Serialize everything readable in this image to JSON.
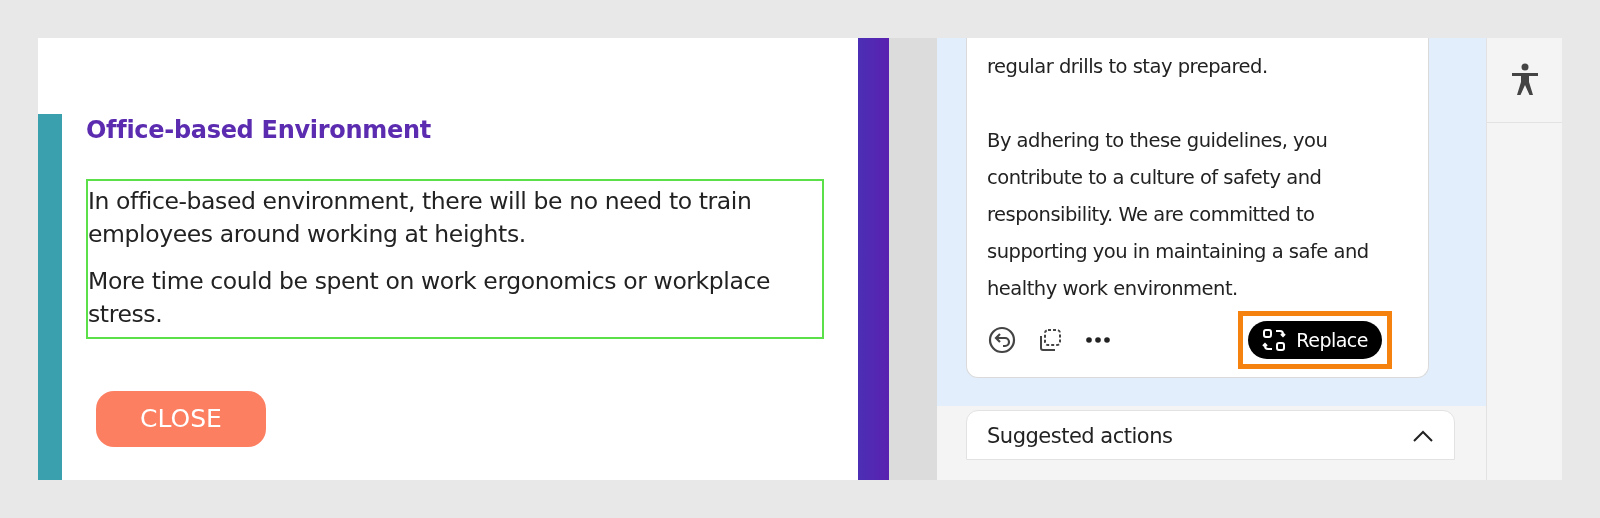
{
  "slide": {
    "heading": "Office-based Environment",
    "paragraphs": [
      "In office-based environment, there will be no need to train employees around working at heights.",
      "More time could be spent on work ergonomics or workplace stress."
    ],
    "paragraphs_highlighted": true,
    "close_button": "CLOSE"
  },
  "assistant": {
    "response_paragraphs": [
      "regular drills to stay prepared.",
      "By adhering to these guidelines, you contribute to a culture of safety and responsibility. We are committed to supporting you in maintaining a safe and healthy work environment."
    ],
    "replace_button": {
      "label": "Replace",
      "highlighted": true
    },
    "suggested_actions": {
      "title": "Suggested actions",
      "expanded": true
    }
  }
}
